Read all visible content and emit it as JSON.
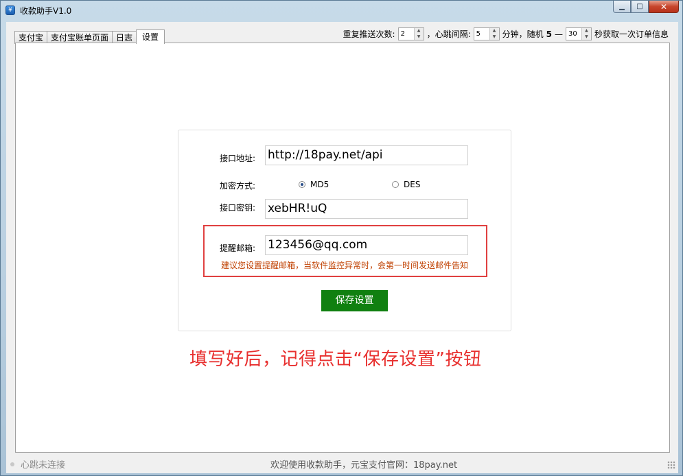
{
  "window": {
    "title": "收款助手V1.0",
    "app_icon": "app-icon",
    "controls": {
      "minimize": "▁",
      "maximize": "□",
      "close": "✕"
    }
  },
  "tabs": [
    {
      "label": "支付宝",
      "active": false
    },
    {
      "label": "支付宝账单页面",
      "active": false
    },
    {
      "label": "日志",
      "active": false
    },
    {
      "label": "设置",
      "active": true
    }
  ],
  "topbar": {
    "repeat_label": "重复推送次数:",
    "repeat_value": "2",
    "heartbeat_label": "，心跳间隔:",
    "heartbeat_value": "5",
    "minutes_label": "分钟，随机",
    "random_min": "5",
    "dash": "—",
    "random_max": "30",
    "seconds_label": "秒获取一次订单信息"
  },
  "settings": {
    "api_url_label": "接口地址:",
    "api_url_value": "http://18pay.net/api",
    "encryption_label": "加密方式:",
    "encryption_options": [
      {
        "label": "MD5",
        "selected": true
      },
      {
        "label": "DES",
        "selected": false
      }
    ],
    "api_key_label": "接口密钥:",
    "api_key_value": "xebHR!uQ",
    "email_label": "提醒邮箱:",
    "email_value": "123456@qq.com",
    "email_hint": "建议您设置提醒邮箱，当软件监控异常时，会第一时间发送邮件告知",
    "save_label": "保存设置"
  },
  "instruction": "填写好后，记得点击“保存设置”按钮",
  "status": {
    "connection": "心跳未连接",
    "welcome": "欢迎使用收款助手，元宝支付官网：18pay.net"
  },
  "colors": {
    "accent_green": "#108010",
    "highlight_red": "#e04040",
    "instruction_red": "#e8302f",
    "hint_orange": "#c04000"
  }
}
